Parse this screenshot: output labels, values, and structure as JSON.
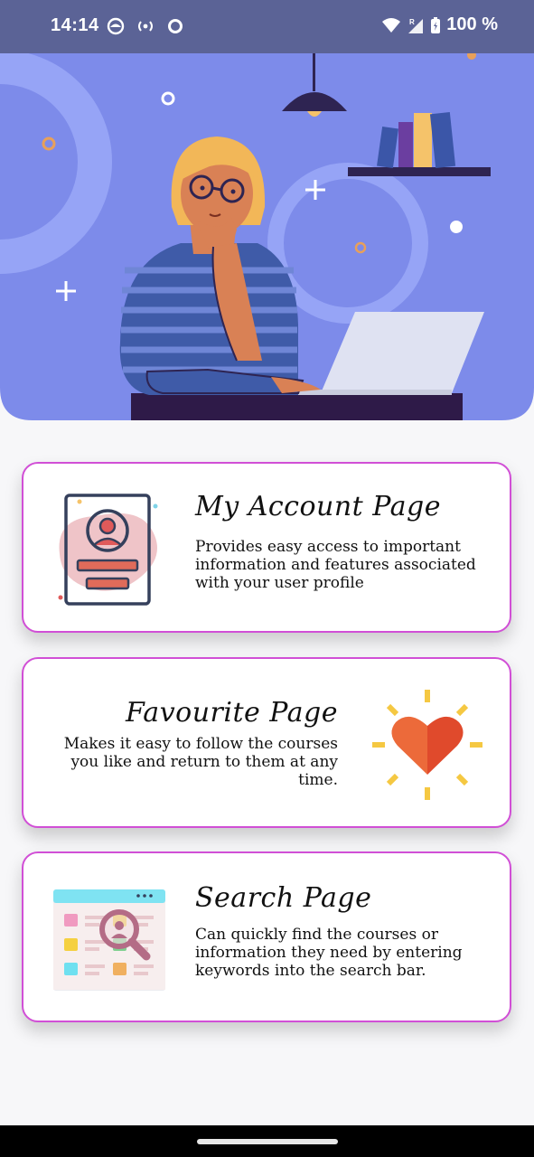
{
  "status_bar": {
    "time": "14:14",
    "battery_text": "100 %"
  },
  "cards": [
    {
      "title": "My Account Page",
      "description": "Provides easy access to important information and features associated with your user profile",
      "icon": "user-profile-icon"
    },
    {
      "title": "Favourite Page",
      "description": "Makes it easy to follow the courses you like and return to them at any time.",
      "icon": "heart-icon"
    },
    {
      "title": "Search Page",
      "description": "Can quickly find the courses or information they need by entering keywords into the search bar.",
      "icon": "search-window-icon"
    }
  ],
  "colors": {
    "status_bar": "#5b6396",
    "hero_bg": "#7d8bea",
    "card_border": "#d14fd6"
  }
}
